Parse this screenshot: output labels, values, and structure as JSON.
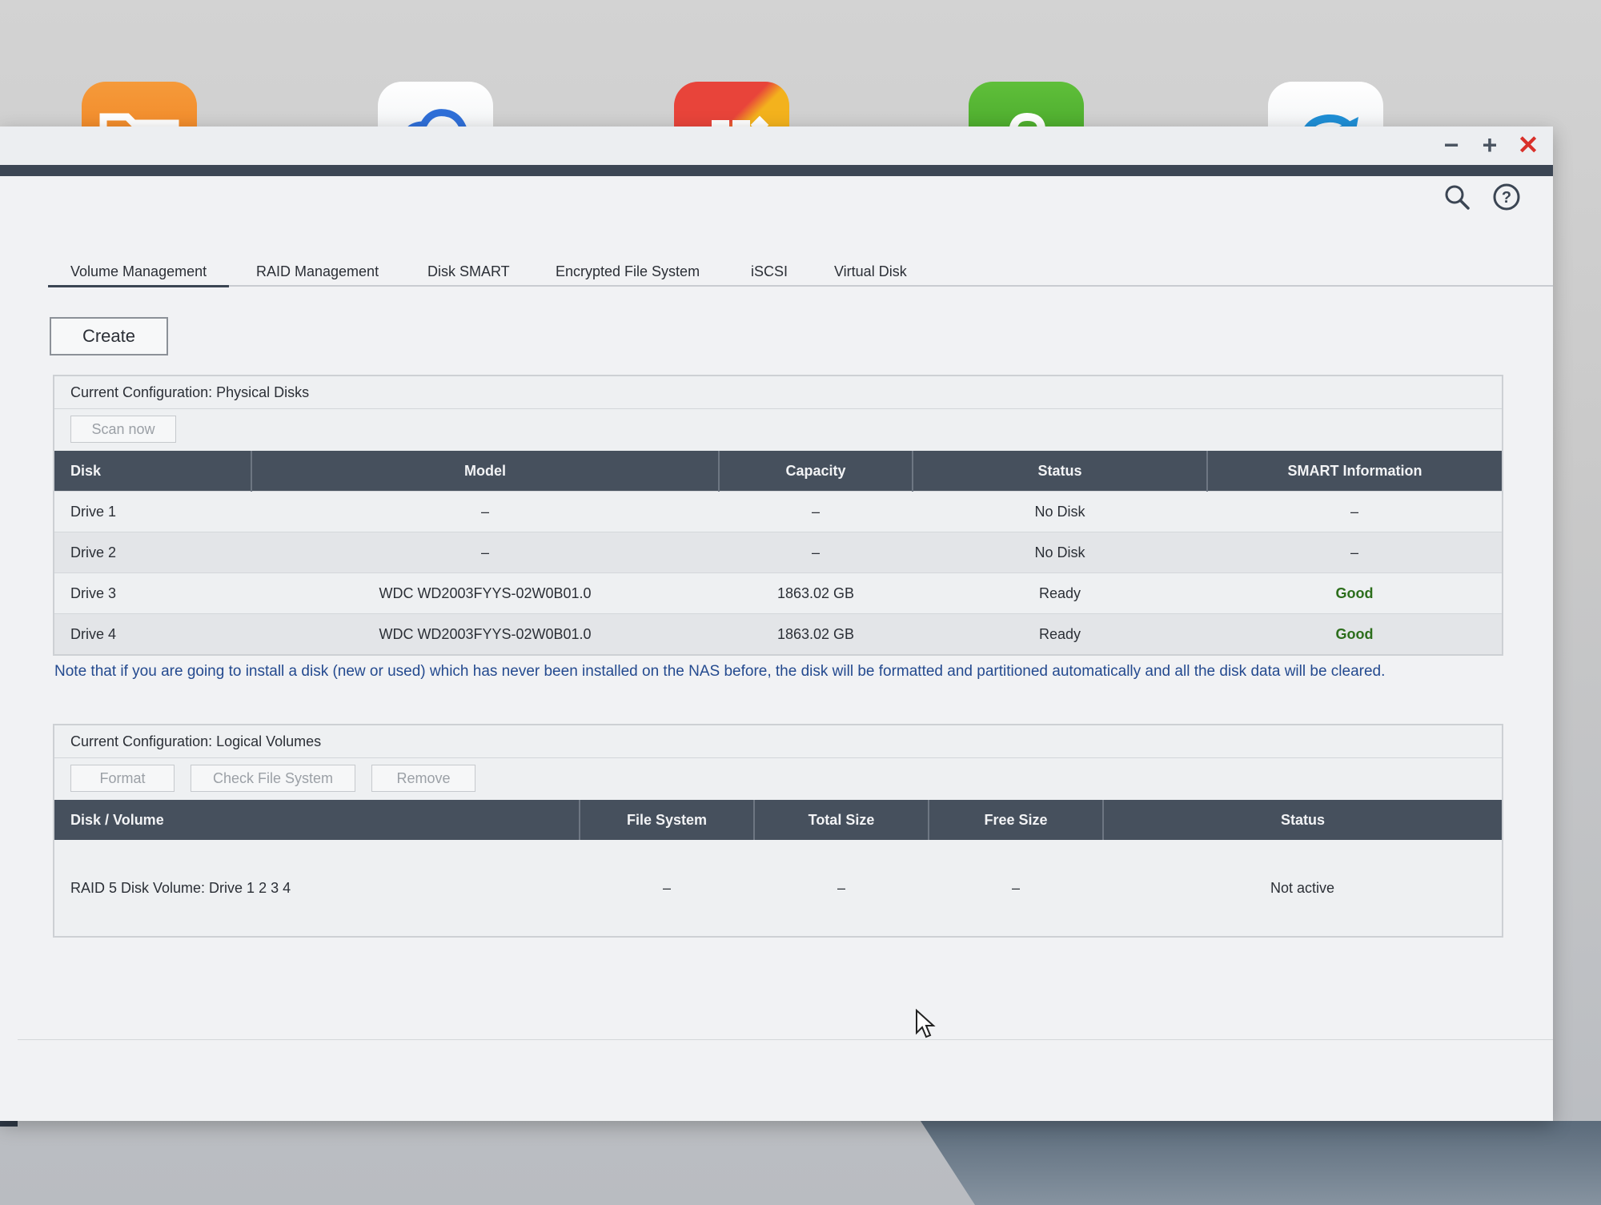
{
  "window": {
    "controls": {
      "minimize": "−",
      "maximize": "+",
      "close": "✕"
    }
  },
  "tabs": [
    {
      "label": "Volume Management"
    },
    {
      "label": "RAID Management"
    },
    {
      "label": "Disk SMART"
    },
    {
      "label": "Encrypted File System"
    },
    {
      "label": "iSCSI"
    },
    {
      "label": "Virtual Disk"
    }
  ],
  "active_tab": "Volume Management",
  "create_label": "Create",
  "physical": {
    "title": "Current Configuration: Physical Disks",
    "scan_label": "Scan now",
    "headers": [
      "Disk",
      "Model",
      "Capacity",
      "Status",
      "SMART Information"
    ],
    "rows": [
      [
        "Drive 1",
        "–",
        "–",
        "No Disk",
        "–"
      ],
      [
        "Drive 2",
        "–",
        "–",
        "No Disk",
        "–"
      ],
      [
        "Drive 3",
        "WDC WD2003FYYS-02W0B01.0",
        "1863.02 GB",
        "Ready",
        "Good"
      ],
      [
        "Drive 4",
        "WDC WD2003FYYS-02W0B01.0",
        "1863.02 GB",
        "Ready",
        "Good"
      ]
    ]
  },
  "note": "Note that if you are going to install a disk (new or used) which has never been installed on the NAS before, the disk will be formatted and partitioned automatically and all the disk data will be cleared.",
  "logical": {
    "title": "Current Configuration: Logical Volumes",
    "buttons": {
      "format": "Format",
      "check": "Check File System",
      "remove": "Remove"
    },
    "headers": [
      "Disk / Volume",
      "File System",
      "Total Size",
      "Free Size",
      "Status"
    ],
    "rows": [
      [
        "RAID 5 Disk Volume: Drive 1 2 3 4",
        "–",
        "–",
        "–",
        "Not active"
      ]
    ]
  },
  "colors": {
    "header_bg": "#46505d",
    "note_text": "#244a8f",
    "good": "#2c6e1c",
    "close": "#d9302a"
  },
  "icons": [
    "file-station-icon",
    "cloud-icon",
    "app-center-icon",
    "backup-icon",
    "sync-icon",
    "search-icon",
    "help-icon"
  ]
}
